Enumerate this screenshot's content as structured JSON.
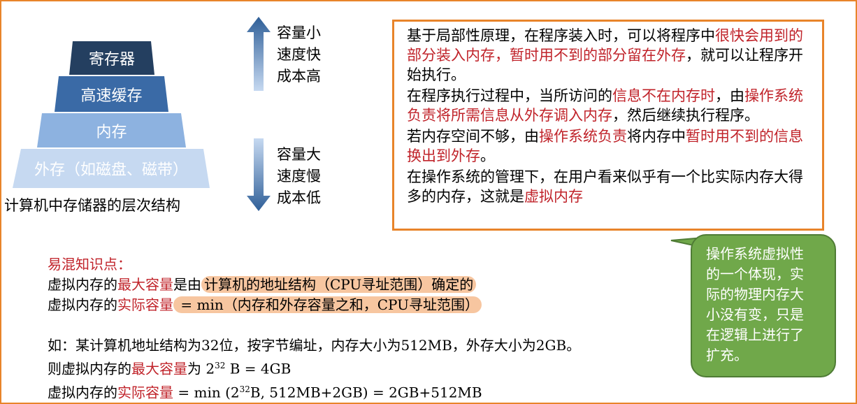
{
  "pyramid": {
    "tiers": [
      "寄存器",
      "高速缓存",
      "内存",
      "外存（如磁盘、磁带）"
    ],
    "caption": "计算机中存储器的层次结构"
  },
  "arrows": {
    "up_label": [
      "容量小",
      "速度快",
      "成本高"
    ],
    "down_label": [
      "容量大",
      "速度慢",
      "成本低"
    ]
  },
  "principle_box": {
    "p1": [
      "基于局部性原理，在程序装入时，可以将程序中",
      "很快会用到的部分装入内存，暂时用不到的部分留在外存",
      "，就可以让程序开始执行。"
    ],
    "p2": [
      "在程序执行过程中，当所访问的",
      "信息不在内存时",
      "，由",
      "操作系统负责将所需信息从外存调入内存",
      "，然后继续执行程序。"
    ],
    "p3": [
      "若内存空间不够，由",
      "操作系统负责",
      "将内存中",
      "暂时用不到的信息换出到外存",
      "。"
    ],
    "p4": [
      "在操作系统的管理下，在用户看来似乎有一个比实际内存大得多的内存，这就是",
      "虚拟内存"
    ]
  },
  "notes": {
    "title": "易混知识点：",
    "line1": [
      "虚拟内存的",
      "最大容量",
      "是由",
      "计算机的地址结构（CPU寻址范围）确定的"
    ],
    "line2": [
      "虚拟内存的",
      "实际容量",
      " = min（内存和外存容量之和，CPU寻址范围）"
    ],
    "line3": "如：某计算机地址结构为32位，按字节编址，内存大小为512MB，外存大小为2GB。",
    "line4": [
      "则虚拟内存的",
      "最大容量",
      "为 2",
      "32",
      " B = 4GB"
    ],
    "line5": [
      "虚拟内存的",
      "实际容量",
      " = min (2",
      "32",
      "B, 512MB+2GB) = 2GB+512MB"
    ]
  },
  "bubble": {
    "text": [
      "操作系统虚拟性",
      "的一个体现，实",
      "际的物理内存大",
      "小没有变，只是",
      "在逻辑上进行了",
      "扩充。"
    ]
  },
  "colors": {
    "accent_border": "#e8842a",
    "red_text": "#c0232a",
    "highlight": "#f7c6a0",
    "bubble_green": "#70a84a"
  }
}
